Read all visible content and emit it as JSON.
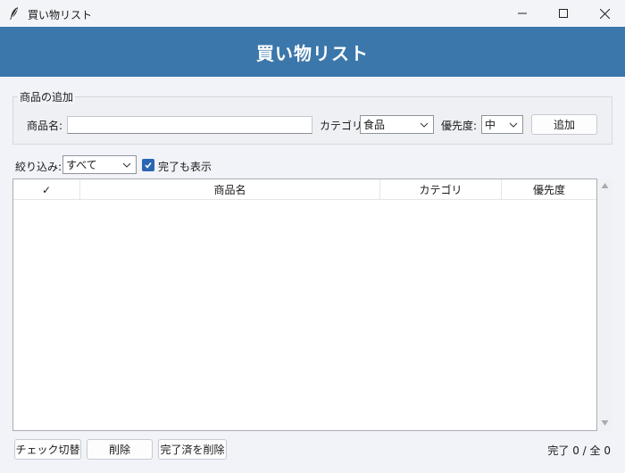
{
  "window": {
    "title": "買い物リスト",
    "icon": "feather-icon"
  },
  "header": {
    "title": "買い物リスト"
  },
  "add_group": {
    "label": "商品の追加",
    "name_label": "商品名:",
    "name_value": "",
    "category_label": "カテゴリ:",
    "category_value": "食品",
    "priority_label": "優先度:",
    "priority_value": "中",
    "add_button": "追加"
  },
  "filter": {
    "label": "絞り込み:",
    "value": "すべて",
    "show_completed_label": "完了も表示",
    "show_completed_checked": true
  },
  "table": {
    "columns": [
      "✓",
      "商品名",
      "カテゴリ",
      "優先度"
    ],
    "rows": []
  },
  "footer": {
    "toggle_button": "チェック切替",
    "delete_button": "削除",
    "delete_completed_button": "完了済を削除",
    "status": "完了 0 / 全 0"
  },
  "colors": {
    "header_bg": "#3b77aa",
    "checkbox_bg": "#2a66b3"
  }
}
